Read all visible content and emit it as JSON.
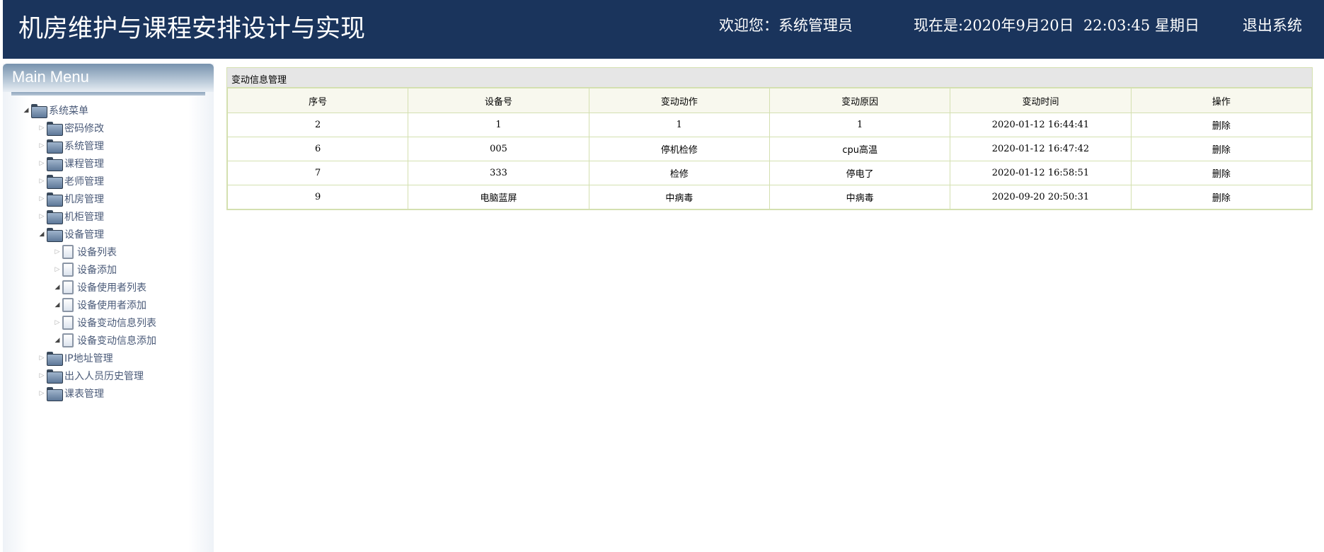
{
  "header": {
    "title": "机房维护与课程安排设计与实现",
    "welcome": "欢迎您：系统管理员",
    "datetime": "现在是:2020年9月20日  22:03:45 星期日",
    "logout": "退出系统"
  },
  "sidebar": {
    "title": "Main Menu",
    "root": "系统菜单",
    "items": [
      "密码修改",
      "系统管理",
      "课程管理",
      "老师管理",
      "机房管理",
      "机柜管理",
      "设备管理",
      "IP地址管理",
      "出入人员历史管理",
      "课表管理"
    ],
    "device_children": [
      "设备列表",
      "设备添加",
      "设备使用者列表",
      "设备使用者添加",
      "设备变动信息列表",
      "设备变动信息添加"
    ]
  },
  "panel": {
    "title": "变动信息管理",
    "columns": [
      "序号",
      "设备号",
      "变动动作",
      "变动原因",
      "变动时间",
      "操作"
    ],
    "rows": [
      [
        "2",
        "1",
        "1",
        "1",
        "2020-01-12 16:44:41",
        "删除"
      ],
      [
        "6",
        "005",
        "停机检修",
        "cpu高温",
        "2020-01-12 16:47:42",
        "删除"
      ],
      [
        "7",
        "333",
        "检修",
        "停电了",
        "2020-01-12 16:58:51",
        "删除"
      ],
      [
        "9",
        "电脑蓝屏",
        "中病毒",
        "中病毒",
        "2020-09-20 20:50:31",
        "删除"
      ]
    ]
  }
}
